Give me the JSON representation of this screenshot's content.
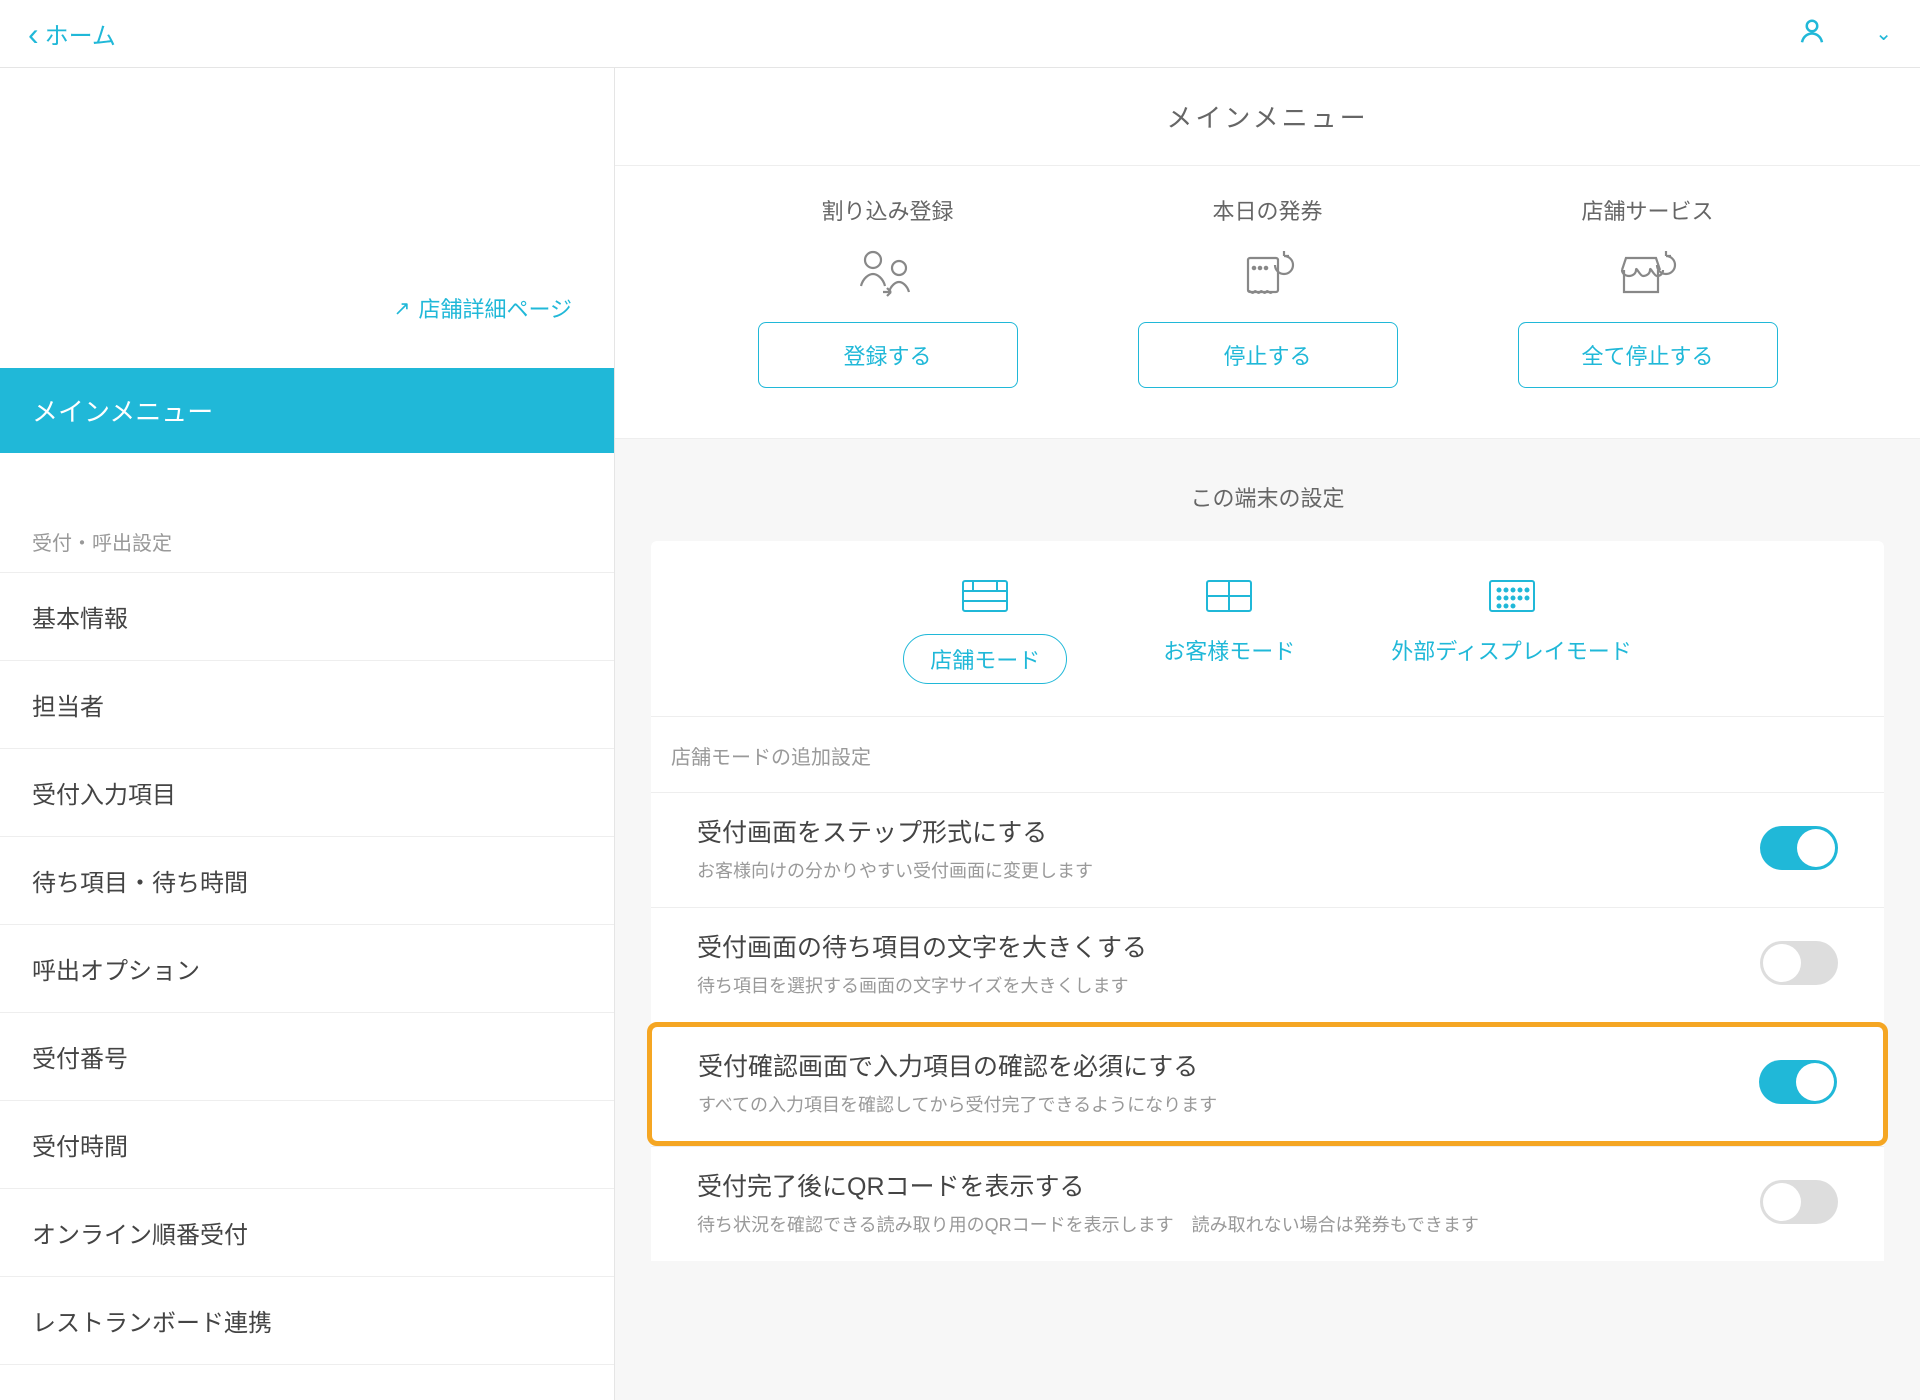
{
  "topbar": {
    "back_label": "ホーム"
  },
  "sidebar": {
    "store_detail_link": "店舗詳細ページ",
    "active_item": "メインメニュー",
    "section_label": "受付・呼出設定",
    "items": [
      "基本情報",
      "担当者",
      "受付入力項目",
      "待ち項目・待ち時間",
      "呼出オプション",
      "受付番号",
      "受付時間",
      "オンライン順番受付",
      "レストランボード連携"
    ]
  },
  "main": {
    "header": "メインメニュー",
    "menu_cards": [
      {
        "title": "割り込み登録",
        "button": "登録する",
        "icon": "people-swap-icon"
      },
      {
        "title": "本日の発券",
        "button": "停止する",
        "icon": "ticket-refresh-icon"
      },
      {
        "title": "店舗サービス",
        "button": "全て停止する",
        "icon": "store-refresh-icon"
      }
    ],
    "device_header": "この端末の設定",
    "mode_tabs": [
      {
        "label": "店舗モード",
        "active": true
      },
      {
        "label": "お客様モード",
        "active": false
      },
      {
        "label": "外部ディスプレイモード",
        "active": false
      }
    ],
    "settings_label": "店舗モードの追加設定",
    "settings": [
      {
        "title": "受付画面をステップ形式にする",
        "desc": "お客様向けの分かりやすい受付画面に変更します",
        "on": true,
        "highlighted": false
      },
      {
        "title": "受付画面の待ち項目の文字を大きくする",
        "desc": "待ち項目を選択する画面の文字サイズを大きくします",
        "on": false,
        "highlighted": false
      },
      {
        "title": "受付確認画面で入力項目の確認を必須にする",
        "desc": "すべての入力項目を確認してから受付完了できるようになります",
        "on": true,
        "highlighted": true
      },
      {
        "title": "受付完了後にQRコードを表示する",
        "desc": "待ち状況を確認できる読み取り用のQRコードを表示します　読み取れない場合は発券もできます",
        "on": false,
        "highlighted": false
      }
    ]
  }
}
